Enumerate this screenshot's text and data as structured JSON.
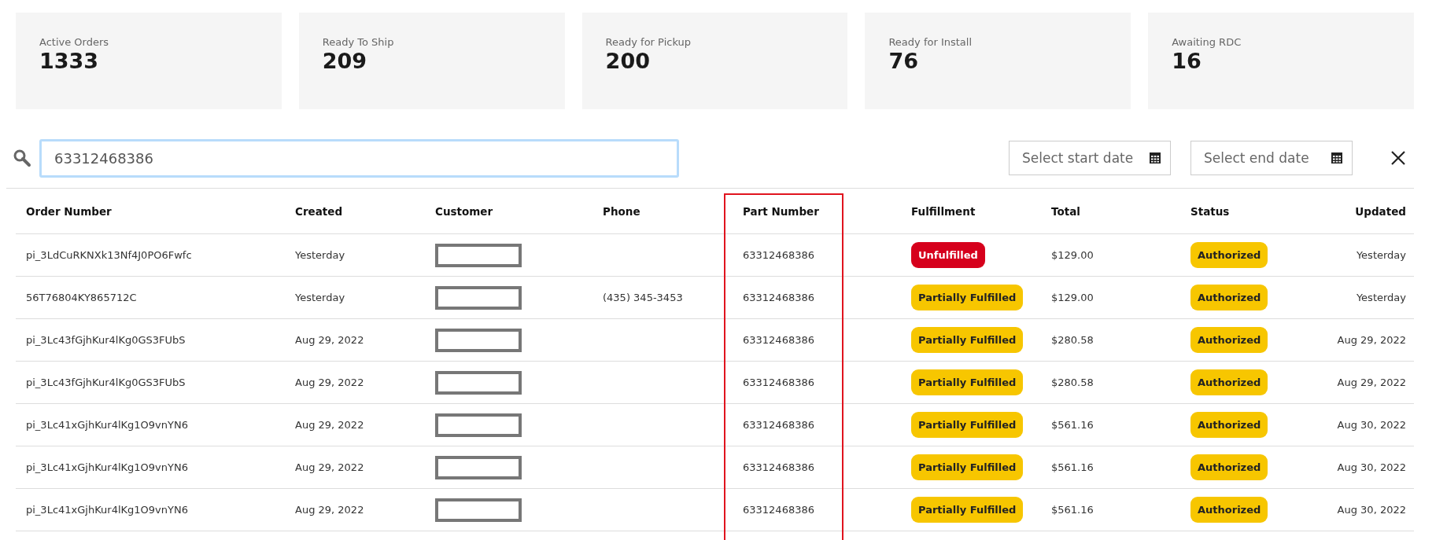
{
  "stats": [
    {
      "label": "Active Orders",
      "value": "1333"
    },
    {
      "label": "Ready To Ship",
      "value": "209"
    },
    {
      "label": "Ready for Pickup",
      "value": "200"
    },
    {
      "label": "Ready for Install",
      "value": "76"
    },
    {
      "label": "Awaiting RDC",
      "value": "16"
    }
  ],
  "search": {
    "value": "63312468386"
  },
  "start_date": {
    "placeholder": "Select start date"
  },
  "end_date": {
    "placeholder": "Select end date"
  },
  "table": {
    "columns": [
      {
        "label": "Order Number",
        "highlighted": false
      },
      {
        "label": "Created",
        "highlighted": false
      },
      {
        "label": "Customer",
        "highlighted": false
      },
      {
        "label": "Phone",
        "highlighted": false
      },
      {
        "label": "Part Number",
        "highlighted": true
      },
      {
        "label": "Fulfillment",
        "highlighted": false
      },
      {
        "label": "Total",
        "highlighted": false
      },
      {
        "label": "Status",
        "highlighted": false
      },
      {
        "label": "Updated",
        "highlighted": false
      }
    ],
    "rows": [
      {
        "order": "pi_3LdCuRKNXk13Nf4J0PO6Fwfc",
        "created": "Yesterday",
        "customer": {
          "kind": "redacted"
        },
        "part": "63312468386",
        "fulfillment": {
          "label": "Unfulfilled",
          "kind": "unfulfilled"
        },
        "total": "$129.00",
        "status": "Authorized",
        "updated": "Yesterday"
      },
      {
        "order": "56T76804KY865712C",
        "created": "Yesterday",
        "customer": {
          "kind": "redacted"
        },
        "phone": "(435) 345-3453",
        "part": "63312468386",
        "fulfillment": {
          "label": "Partially Fulfilled",
          "kind": "partial"
        },
        "total": "$129.00",
        "status": "Authorized",
        "updated": "Yesterday"
      },
      {
        "order": "pi_3Lc43fGjhKur4lKg0GS3FUbS",
        "created": "Aug 29, 2022",
        "customer": {
          "kind": "redacted"
        },
        "part": "63312468386",
        "fulfillment": {
          "label": "Partially Fulfilled",
          "kind": "partial"
        },
        "total": "$280.58",
        "status": "Authorized",
        "updated": "Aug 29, 2022"
      },
      {
        "order": "pi_3Lc43fGjhKur4lKg0GS3FUbS",
        "created": "Aug 29, 2022",
        "customer": {
          "kind": "redacted"
        },
        "part": "63312468386",
        "fulfillment": {
          "label": "Partially Fulfilled",
          "kind": "partial"
        },
        "total": "$280.58",
        "status": "Authorized",
        "updated": "Aug 29, 2022"
      },
      {
        "order": "pi_3Lc41xGjhKur4lKg1O9vnYN6",
        "created": "Aug 29, 2022",
        "customer": {
          "kind": "redacted"
        },
        "part": "63312468386",
        "fulfillment": {
          "label": "Partially Fulfilled",
          "kind": "partial"
        },
        "total": "$561.16",
        "status": "Authorized",
        "updated": "Aug 30, 2022"
      },
      {
        "order": "pi_3Lc41xGjhKur4lKg1O9vnYN6",
        "created": "Aug 29, 2022",
        "customer": {
          "kind": "redacted"
        },
        "part": "63312468386",
        "fulfillment": {
          "label": "Partially Fulfilled",
          "kind": "partial"
        },
        "total": "$561.16",
        "status": "Authorized",
        "updated": "Aug 30, 2022"
      },
      {
        "order": "pi_3Lc41xGjhKur4lKg1O9vnYN6",
        "created": "Aug 29, 2022",
        "customer": {
          "kind": "redacted"
        },
        "part": "63312468386",
        "fulfillment": {
          "label": "Partially Fulfilled",
          "kind": "partial"
        },
        "total": "$561.16",
        "status": "Authorized",
        "updated": "Aug 30, 2022"
      }
    ]
  }
}
